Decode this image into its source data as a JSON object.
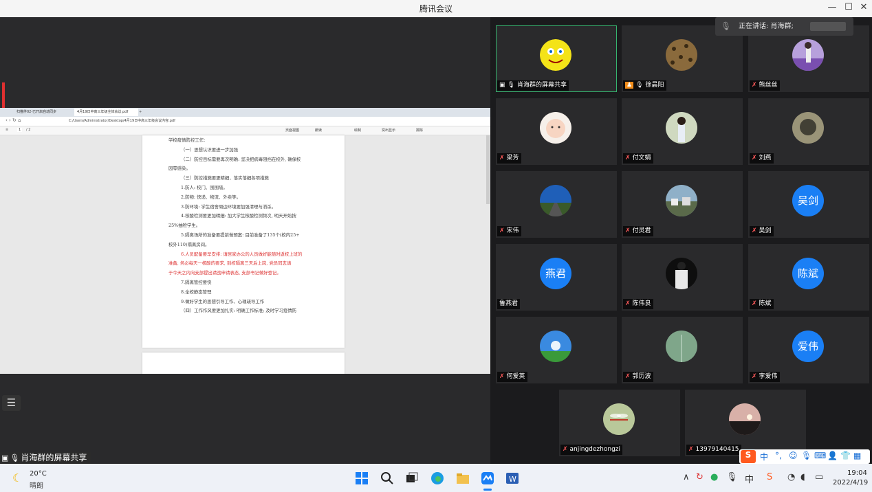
{
  "app": {
    "title": "腾讯会议"
  },
  "window_controls": {
    "minimize": "—",
    "maximize": "☐",
    "close": "✕"
  },
  "browser": {
    "tabs": [
      "扫描件02-已开启自动同步",
      "4月19日中高三年级全体会议.pdf"
    ],
    "address": "C:/Users/Administrator/Desktop/4月19日中高三年级会议内容.pdf",
    "page_current": "1",
    "page_total": "/ 2",
    "tools": [
      "页面视图",
      "朗读",
      "绘制",
      "突出显示",
      "擦除"
    ]
  },
  "document": {
    "lines": [
      {
        "text": "学校疫情防控工作:",
        "red": false
      },
      {
        "text": "（一）思想认识要进一步加强",
        "red": false
      },
      {
        "text": "（二）防控目标需要再次明确: 坚决把病毒阻挡在校外, 确保校",
        "red": false
      },
      {
        "text": "园零感染。",
        "red": false
      },
      {
        "text": "（三）防控措施要更精细，落实落细各项措施",
        "red": false
      },
      {
        "text": "1.防人: 校门、围围墙。",
        "red": false
      },
      {
        "text": "2.防物: 快递、物流、外卖等。",
        "red": false
      },
      {
        "text": "3.防环境: 学生宿舍周边环境要加强清理与消杀。",
        "red": false
      },
      {
        "text": "4.核酸检测要更加精细: 加大学生核酸检测频次, 明天开始按",
        "red": false
      },
      {
        "text": "25%抽检学生。",
        "red": false
      },
      {
        "text": "5.隔离场所的准备要提前做预案: 目前准备了135个(校内25+",
        "red": false
      },
      {
        "text": "校外110)隔离房间。",
        "red": false
      },
      {
        "text": "6.人员配备要早安排: 请居家办公的人员做好能随时返校上班的",
        "red": true
      },
      {
        "text": "准备, 务必每天一核酸的要求, 到校隔离三天后上岗, 党员同志请",
        "red": true
      },
      {
        "text": "于今天之内向支部提出请战申请表态, 支部书记做好登记。",
        "red": true
      },
      {
        "text": "7.隔离管控要快",
        "red": false
      },
      {
        "text": "8.全校静态管理",
        "red": false
      },
      {
        "text": "9.做好学生的思想引导工作、心理疏导工作",
        "red": false
      },
      {
        "text": "（四）工作作风要更加扎实: 明确工作标准; 及时学习疫情防",
        "red": false
      }
    ]
  },
  "share_label": "肖海群的屏幕共享",
  "speaking": {
    "label": "正在讲话: 肖海群;"
  },
  "participants": [
    {
      "name": "肖海群的屏幕共享",
      "mic": "on",
      "avatar": "sponge"
    },
    {
      "name": "徐晨阳",
      "mic": "on",
      "avatar": "leopard"
    },
    {
      "name": "熊丝丝",
      "mic": "off",
      "avatar": "lavender"
    },
    {
      "name": "梁芳",
      "mic": "off",
      "avatar": "baby"
    },
    {
      "name": "付文娟",
      "mic": "off",
      "avatar": "girl"
    },
    {
      "name": "刘燕",
      "mic": "off",
      "avatar": "blurry"
    },
    {
      "name": "宋伟",
      "mic": "off",
      "avatar": "road"
    },
    {
      "name": "付灵君",
      "mic": "off",
      "avatar": "town"
    },
    {
      "name": "吴剑",
      "mic": "off",
      "avatar_text": "吴剑"
    },
    {
      "name": "鲁燕君",
      "mic": "none",
      "avatar_text": "燕君"
    },
    {
      "name": "陈伟良",
      "mic": "off",
      "avatar": "man"
    },
    {
      "name": "陈斌",
      "mic": "off",
      "avatar_text": "陈斌"
    },
    {
      "name": "何爱英",
      "mic": "off",
      "avatar": "dandelion"
    },
    {
      "name": "郭历波",
      "mic": "off",
      "avatar": "grass"
    },
    {
      "name": "李爱伟",
      "mic": "off",
      "avatar_text": "爱伟"
    },
    {
      "name": "anjingdezhongzi",
      "mic": "off",
      "avatar": "dragonfly"
    },
    {
      "name": "13979140415",
      "mic": "off",
      "avatar": "sunset"
    }
  ],
  "ime": {
    "chinese": "中"
  },
  "taskbar": {
    "weather_temp": "20°C",
    "weather_desc": "晴朗",
    "time": "19:04",
    "date": "2022/4/19",
    "ime_indicator": "中"
  },
  "colors": {
    "accent": "#1a7ff5",
    "speaking_border": "#36b46f",
    "mic_muted": "#ff5a5a",
    "highlight_text": "#d33"
  }
}
